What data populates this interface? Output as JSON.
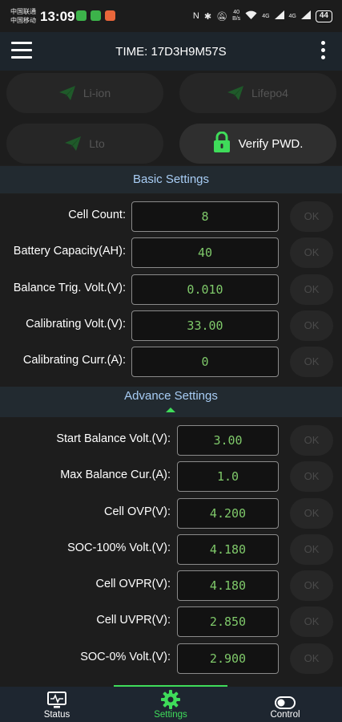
{
  "status_bar": {
    "carrier1": "中国联通",
    "carrier2": "中国移动",
    "time": "13:09",
    "net_speed_value": "40",
    "net_speed_unit": "B/s",
    "signal1": "4G",
    "signal2": "4G",
    "battery": "44"
  },
  "app_bar": {
    "title": "TIME: 17D3H9M57S"
  },
  "battery_types": {
    "liion": "Li-ion",
    "lifepo4": "Lifepo4",
    "lto": "Lto",
    "verify": "Verify PWD."
  },
  "basic": {
    "title": "Basic Settings",
    "ok_label": "OK",
    "rows": [
      {
        "label": "Cell Count:",
        "value": "8"
      },
      {
        "label": "Battery Capacity(AH):",
        "value": "40"
      },
      {
        "label": "Balance Trig. Volt.(V):",
        "value": "0.010"
      },
      {
        "label": "Calibrating Volt.(V):",
        "value": "33.00"
      },
      {
        "label": "Calibrating Curr.(A):",
        "value": "0"
      }
    ]
  },
  "advance": {
    "title": "Advance Settings",
    "ok_label": "OK",
    "rows": [
      {
        "label": "Start Balance Volt.(V):",
        "value": "3.00"
      },
      {
        "label": "Max Balance Cur.(A):",
        "value": "1.0"
      },
      {
        "label": "Cell OVP(V):",
        "value": "4.200"
      },
      {
        "label": "SOC-100% Volt.(V):",
        "value": "4.180"
      },
      {
        "label": "Cell OVPR(V):",
        "value": "4.180"
      },
      {
        "label": "Cell UVPR(V):",
        "value": "2.850"
      },
      {
        "label": "SOC-0% Volt.(V):",
        "value": "2.900"
      }
    ]
  },
  "bottom_nav": {
    "status": "Status",
    "settings": "Settings",
    "control": "Control",
    "active": "settings"
  },
  "colors": {
    "accent_green": "#3fdc5a",
    "value_green": "#7fc96a",
    "section_title": "#a8cdf5"
  }
}
